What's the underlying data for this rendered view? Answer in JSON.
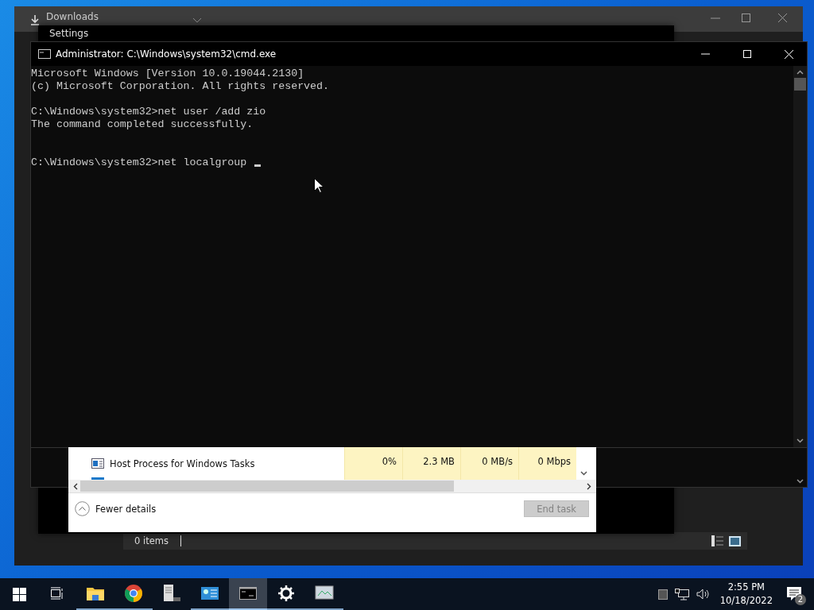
{
  "explorer": {
    "tab": "Downloads",
    "status": "0 items"
  },
  "settings": {
    "title": "Settings"
  },
  "cmd": {
    "title": "Administrator: C:\\Windows\\system32\\cmd.exe",
    "cursor_visible": true,
    "blocks": [
      {
        "lines": [
          "Microsoft Windows [Version 10.0.19044.2130]",
          "(c) Microsoft Corporation. All rights reserved."
        ]
      },
      {
        "lines": [
          "C:\\Windows\\system32>net user /add zio",
          "The command completed successfully."
        ]
      },
      {
        "lines": [
          "C:\\Windows\\system32>net localgroup "
        ]
      }
    ]
  },
  "task_manager": {
    "row": {
      "name": "Host Process for Windows Tasks",
      "cells": [
        "0%",
        "2.3 MB",
        "0 MB/s",
        "0 Mbps"
      ]
    },
    "details_toggle": "Fewer details",
    "end_task": {
      "label": "End task",
      "disabled": true
    }
  },
  "taskbar": {
    "apps": [
      {
        "kind": "taskview",
        "running": false,
        "selected": false
      },
      {
        "kind": "folder",
        "running": true,
        "selected": false
      },
      {
        "kind": "chrome",
        "running": true,
        "selected": false
      },
      {
        "kind": "server",
        "running": false,
        "selected": false
      },
      {
        "kind": "panel",
        "running": true,
        "selected": false
      },
      {
        "kind": "terminal",
        "running": true,
        "selected": true
      },
      {
        "kind": "gear",
        "running": true,
        "selected": false
      },
      {
        "kind": "monitor",
        "running": true,
        "selected": false
      }
    ],
    "time": "2:55 PM",
    "date": "10/18/2022",
    "notifications": "2"
  }
}
